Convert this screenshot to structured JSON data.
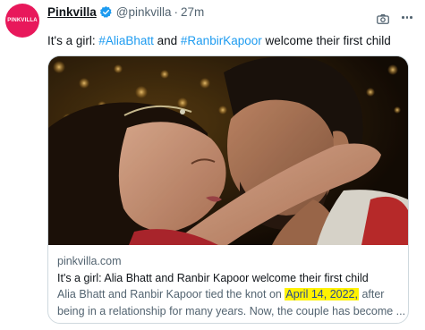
{
  "author": {
    "avatar_text": "PINKVILLA",
    "name": "Pinkvilla",
    "handle": "@pinkvilla",
    "separator": "·",
    "time": "27m"
  },
  "tweet": {
    "prefix": "It's a girl: ",
    "hashtag1": "#AliaBhatt",
    "middle": " and ",
    "hashtag2": "#RanbirKapoor",
    "suffix": " welcome their first child"
  },
  "card": {
    "domain": "pinkvilla.com",
    "title": "It's a girl: Alia Bhatt and Ranbir Kapoor welcome their first child",
    "desc_part1": "Alia Bhatt and Ranbir Kapoor tied the knot on",
    "desc_highlight": "April 14, 2022,",
    "desc_part2": " after",
    "desc_line2": "being in a relationship for many years. Now, the couple has become ..."
  },
  "colors": {
    "avatar_bg": "#e8185b",
    "link": "#1d9bf0",
    "highlight": "#fff200",
    "verified": "#1d9bf0"
  },
  "icons": [
    "verified-badge-icon",
    "camera-icon",
    "more-icon"
  ]
}
